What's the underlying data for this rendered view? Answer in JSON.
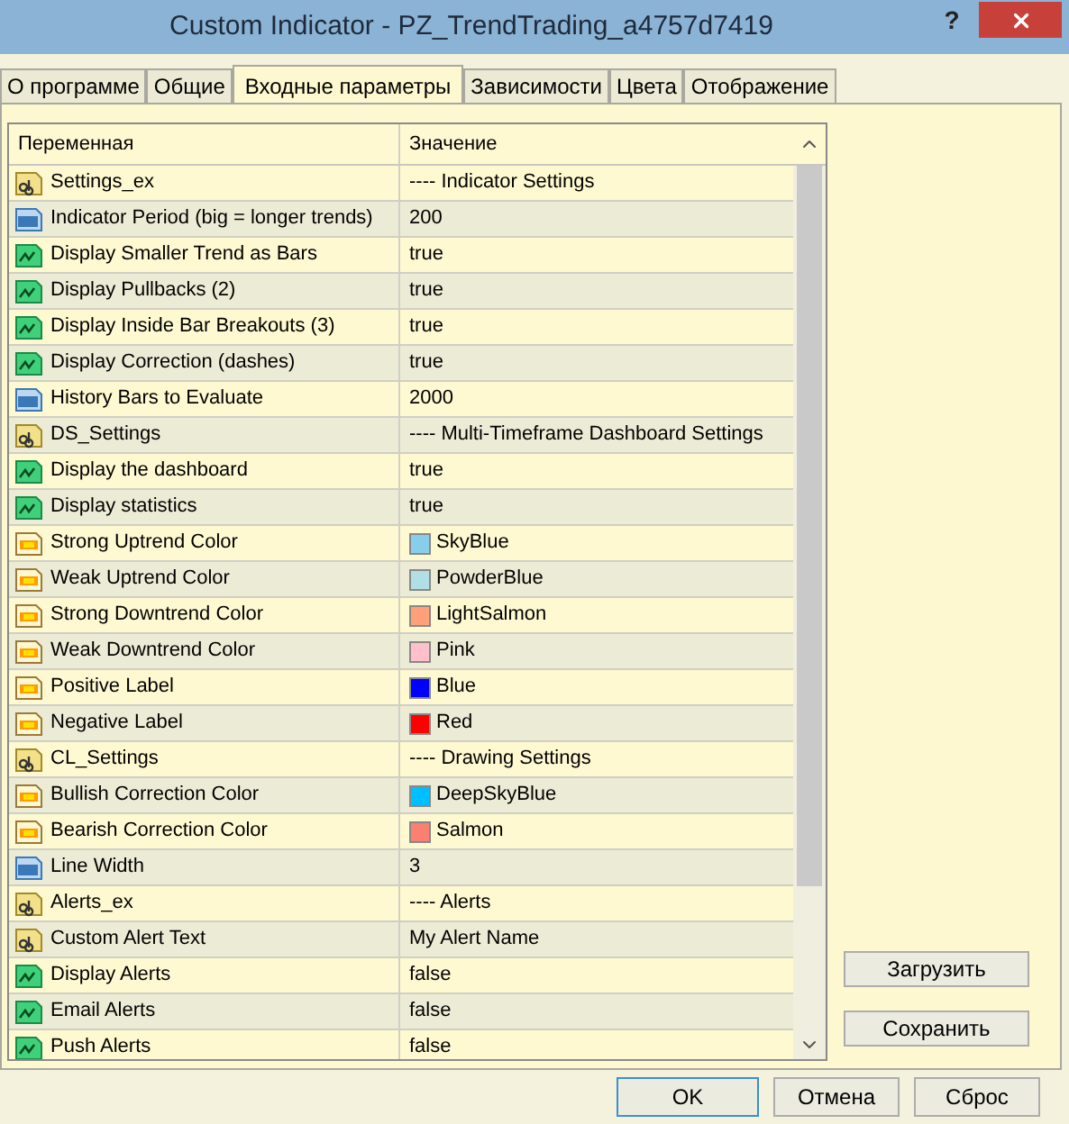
{
  "window": {
    "title": "Custom Indicator - PZ_TrendTrading_a4757d7419",
    "help": "?"
  },
  "tabs": [
    {
      "label": "О программе",
      "selected": false
    },
    {
      "label": "Общие",
      "selected": false
    },
    {
      "label": "Входные параметры",
      "selected": true
    },
    {
      "label": "Зависимости",
      "selected": false
    },
    {
      "label": "Цвета",
      "selected": false
    },
    {
      "label": "Отображение",
      "selected": false
    }
  ],
  "table": {
    "columns": [
      "Переменная",
      "Значение"
    ],
    "rows": [
      {
        "kind": "string",
        "name": "Settings_ex",
        "value": "---- Indicator Settings"
      },
      {
        "kind": "number",
        "name": "Indicator Period (big = longer trends)",
        "value": "200"
      },
      {
        "kind": "bool",
        "name": "Display Smaller Trend as Bars",
        "value": "true"
      },
      {
        "kind": "bool",
        "name": "Display Pullbacks (2)",
        "value": "true"
      },
      {
        "kind": "bool",
        "name": "Display Inside Bar Breakouts (3)",
        "value": "true"
      },
      {
        "kind": "bool",
        "name": "Display Correction (dashes)",
        "value": "true"
      },
      {
        "kind": "number",
        "name": "History Bars to Evaluate",
        "value": "2000"
      },
      {
        "kind": "string",
        "name": "DS_Settings",
        "value": "---- Multi-Timeframe Dashboard Settings"
      },
      {
        "kind": "bool",
        "name": "Display the dashboard",
        "value": "true"
      },
      {
        "kind": "bool",
        "name": "Display statistics",
        "value": "true"
      },
      {
        "kind": "color",
        "name": "Strong Uptrend Color",
        "value": "SkyBlue",
        "color": "#87ceeb"
      },
      {
        "kind": "color",
        "name": "Weak Uptrend Color",
        "value": "PowderBlue",
        "color": "#b0e0e6"
      },
      {
        "kind": "color",
        "name": "Strong Downtrend Color",
        "value": "LightSalmon",
        "color": "#ffa07a"
      },
      {
        "kind": "color",
        "name": "Weak Downtrend Color",
        "value": "Pink",
        "color": "#ffc0cb"
      },
      {
        "kind": "color",
        "name": "Positive Label",
        "value": "Blue",
        "color": "#0000ff"
      },
      {
        "kind": "color",
        "name": "Negative Label",
        "value": "Red",
        "color": "#ff0000"
      },
      {
        "kind": "string",
        "name": "CL_Settings",
        "value": "---- Drawing Settings"
      },
      {
        "kind": "color",
        "name": "Bullish Correction Color",
        "value": "DeepSkyBlue",
        "color": "#00bfff"
      },
      {
        "kind": "color",
        "name": "Bearish Correction Color",
        "value": "Salmon",
        "color": "#fa8072"
      },
      {
        "kind": "number",
        "name": "Line Width",
        "value": "3"
      },
      {
        "kind": "string",
        "name": "Alerts_ex",
        "value": "---- Alerts"
      },
      {
        "kind": "string",
        "name": "Custom Alert Text",
        "value": "My Alert Name"
      },
      {
        "kind": "bool",
        "name": "Display Alerts",
        "value": "false"
      },
      {
        "kind": "bool",
        "name": "Email Alerts",
        "value": "false"
      },
      {
        "kind": "bool",
        "name": "Push Alerts",
        "value": "false"
      }
    ]
  },
  "side_buttons": [
    "Загрузить",
    "Сохранить"
  ],
  "buttons": [
    {
      "label": "OK",
      "selected": true
    },
    {
      "label": "Отмена",
      "selected": false
    },
    {
      "label": "Сброс",
      "selected": false
    }
  ]
}
